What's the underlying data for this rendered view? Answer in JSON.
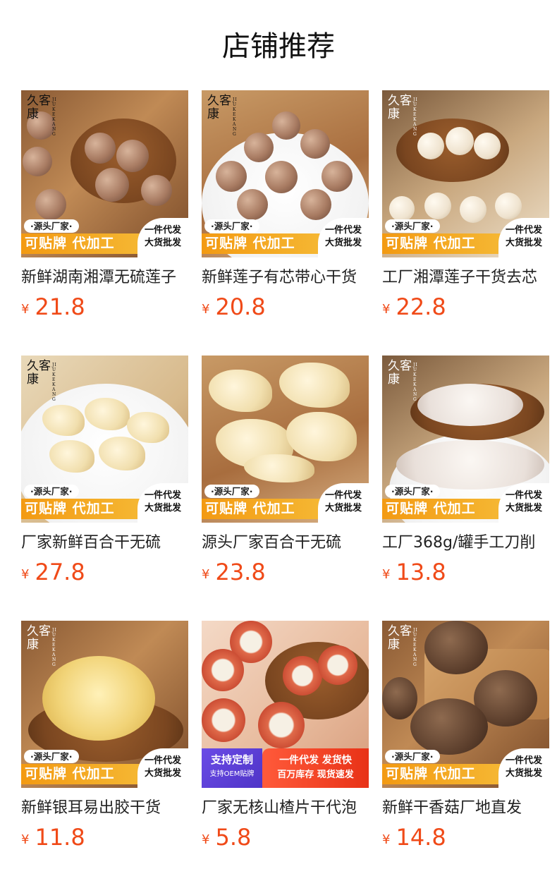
{
  "section_title": "店铺推荐",
  "brand": {
    "name": "久客康",
    "sub": "JIUKEKANG"
  },
  "promo": {
    "tag": "·源头厂家·",
    "main": "可贴牌 代加工",
    "right_line1": "一件代发",
    "right_line2": "大货批发"
  },
  "promo_alt": {
    "left_line1": "支持定制",
    "left_line2": "支持OEM贴牌",
    "right_line1": "一件代发 发货快",
    "right_line2": "百万库存 现货速发"
  },
  "currency": "¥",
  "colors": {
    "price": "#f04a18",
    "promo_orange": "#f39a12",
    "promo_purple": "#5a3fd6",
    "promo_red": "#f04423"
  },
  "products": [
    {
      "name": "新鲜湖南湘潭无硫莲子",
      "price": "21.8",
      "image": "lotus-seeds-with-skin"
    },
    {
      "name": "新鲜莲子有芯带心干货",
      "price": "20.8",
      "image": "lotus-seeds-with-skin"
    },
    {
      "name": "工厂湘潭莲子干货去芯",
      "price": "22.8",
      "image": "white-lotus-seeds"
    },
    {
      "name": "厂家新鲜百合干无硫",
      "price": "27.8",
      "image": "dried-lily"
    },
    {
      "name": "源头厂家百合干无硫",
      "price": "23.8",
      "image": "dried-lily"
    },
    {
      "name": "工厂368g/罐手工刀削",
      "price": "13.8",
      "image": "powder"
    },
    {
      "name": "新鲜银耳易出胶干货",
      "price": "11.8",
      "image": "white-fungus"
    },
    {
      "name": "厂家无核山楂片干代泡",
      "price": "5.8",
      "image": "hawthorn-slices"
    },
    {
      "name": "新鲜干香菇厂地直发",
      "price": "14.8",
      "image": "shiitake"
    }
  ]
}
